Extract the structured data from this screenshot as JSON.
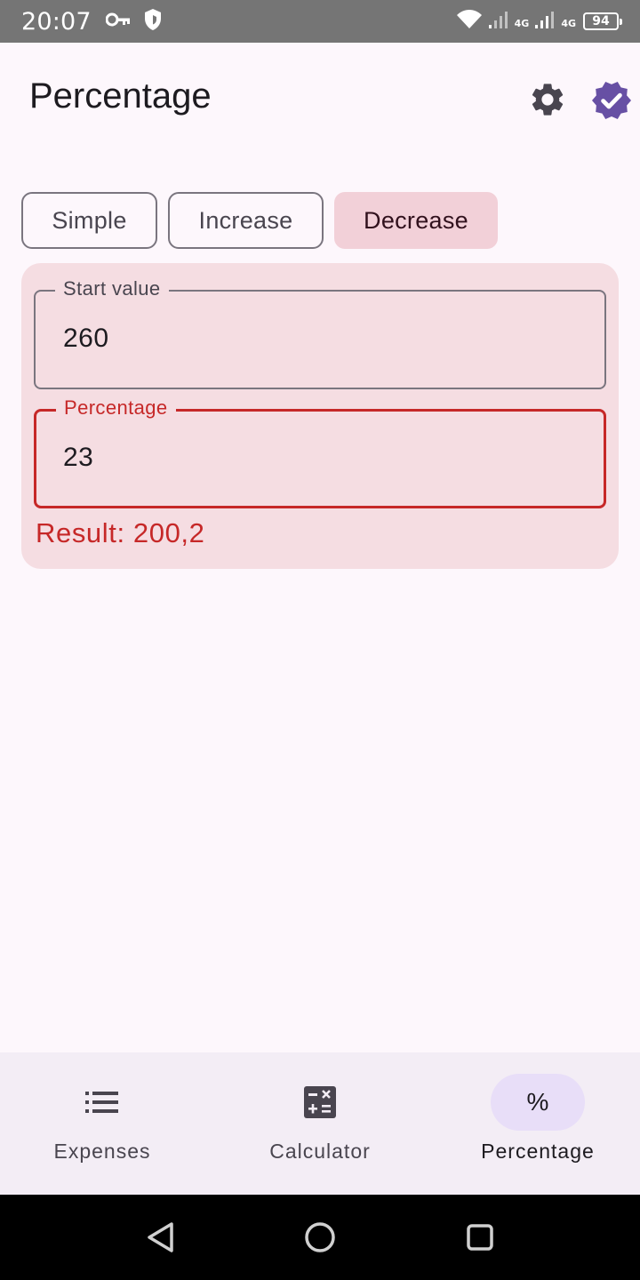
{
  "status_bar": {
    "time": "20:07",
    "network_label_1": "4G",
    "network_label_2": "4G",
    "battery_level": "94",
    "icons": [
      "key-icon",
      "shield-icon",
      "wifi-icon",
      "signal-icon",
      "signal-icon",
      "battery-icon"
    ]
  },
  "header": {
    "title": "Percentage",
    "icons": [
      "gear-icon",
      "verified-badge-icon"
    ],
    "accent_color": "#6750a4"
  },
  "tabs": [
    {
      "label": "Simple",
      "selected": false
    },
    {
      "label": "Increase",
      "selected": false
    },
    {
      "label": "Decrease",
      "selected": true
    }
  ],
  "form": {
    "start_value": {
      "label": "Start value",
      "value": "260"
    },
    "percentage": {
      "label": "Percentage",
      "value": "23"
    },
    "result": "Result: 200,2",
    "error_color": "#c62828"
  },
  "bottom_nav": {
    "items": [
      {
        "label": "Expenses",
        "icon": "list-icon",
        "active": false
      },
      {
        "label": "Calculator",
        "icon": "calculator-icon",
        "active": false
      },
      {
        "label": "Percentage",
        "icon": "percent-icon",
        "glyph": "%",
        "active": true
      }
    ]
  },
  "system_nav": {
    "icons": [
      "back-icon",
      "home-icon",
      "recents-icon"
    ]
  }
}
